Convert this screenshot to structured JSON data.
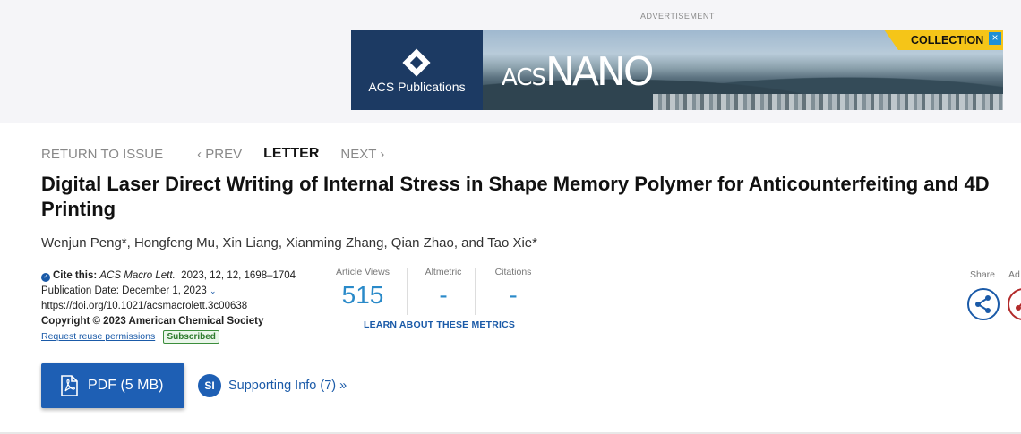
{
  "advertisement": {
    "label": "ADVERTISEMENT",
    "publisher": "ACS Publications",
    "journal_brand_prefix": "ACS",
    "journal_brand_name": "NANO",
    "collection_label": "COLLECTION",
    "close_glyph": "×",
    "colors": {
      "publisher_bg": "#1c3a63",
      "collection_bg": "#f5c518",
      "close_bg": "#1e90d6"
    }
  },
  "nav": {
    "return": "RETURN TO ISSUE",
    "prev": "‹ PREV",
    "current": "LETTER",
    "next": "NEXT ›"
  },
  "article": {
    "title": "Digital Laser Direct Writing of Internal Stress in Shape Memory Polymer for Anticounterfeiting and 4D Printing",
    "authors": "Wenjun Peng*, Hongfeng Mu, Xin Liang, Xianming Zhang, Qian Zhao, and Tao Xie*"
  },
  "citation": {
    "cite_label": "Cite this:",
    "journal": "ACS Macro Lett.",
    "details": "2023, 12, 12, 1698–1704",
    "pub_date": "Publication Date: December 1, 2023",
    "doi": "https://doi.org/10.1021/acsmacrolett.3c00638",
    "copyright": "Copyright © 2023 American Chemical Society",
    "reuse_link": "Request reuse permissions",
    "subscribed_badge": "Subscribed"
  },
  "metrics": {
    "article_views_label": "Article Views",
    "article_views_value": "515",
    "altmetric_label": "Altmetric",
    "altmetric_value": "-",
    "citations_label": "Citations",
    "citations_value": "-",
    "learn_link": "LEARN ABOUT THESE METRICS"
  },
  "actions": {
    "share_label": "Share",
    "add_label": "Ad",
    "pdf_label": "PDF (5 MB)",
    "si_badge": "SI",
    "supporting_info": "Supporting Info (7) »"
  },
  "icons": [
    "check-circle-icon",
    "chevron-down-icon",
    "pdf-file-icon",
    "share-icon",
    "add-icon"
  ],
  "colors": {
    "accent": "#1a5aa8",
    "metric_value": "#2a8ac9",
    "pdf_button": "#1e5fb4"
  }
}
